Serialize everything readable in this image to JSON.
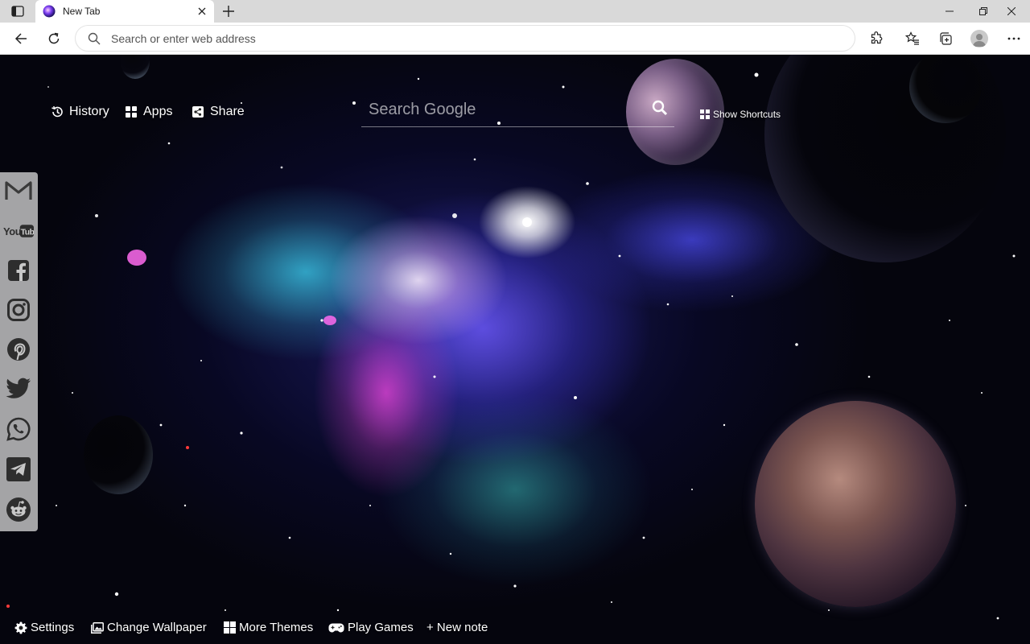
{
  "browser": {
    "tab": {
      "title": "New Tab"
    },
    "address_bar": {
      "placeholder": "Search or enter web address",
      "value": ""
    },
    "icons": {
      "tab_actions": "tab-actions-icon",
      "close_tab": "close-icon",
      "new_tab": "plus-icon",
      "minimize": "minimize-icon",
      "maximize": "restore-icon",
      "close_window": "close-icon",
      "back": "back-arrow-icon",
      "refresh": "refresh-icon",
      "extensions": "puzzle-icon",
      "favorites": "star-list-icon",
      "collections": "collections-icon",
      "profile": "profile-avatar-icon",
      "more": "more-dots-icon"
    }
  },
  "newtab": {
    "top_links": {
      "history": "History",
      "apps": "Apps",
      "share": "Share"
    },
    "search": {
      "placeholder": "Search Google",
      "value": ""
    },
    "show_shortcuts": "Show Shortcuts",
    "social": [
      "gmail",
      "youtube",
      "facebook",
      "instagram",
      "pinterest",
      "twitter",
      "whatsapp",
      "telegram",
      "reddit"
    ],
    "bottom_links": {
      "settings": "Settings",
      "change_wallpaper": "Change Wallpaper",
      "more_themes": "More Themes",
      "play_games": "Play Games",
      "new_note": "+ New note"
    }
  },
  "colors": {
    "tabstrip": "#d9d9d9",
    "toolbar": "#ffffff",
    "sidebar": "#c8c8c8",
    "text_light": "#ffffff"
  }
}
